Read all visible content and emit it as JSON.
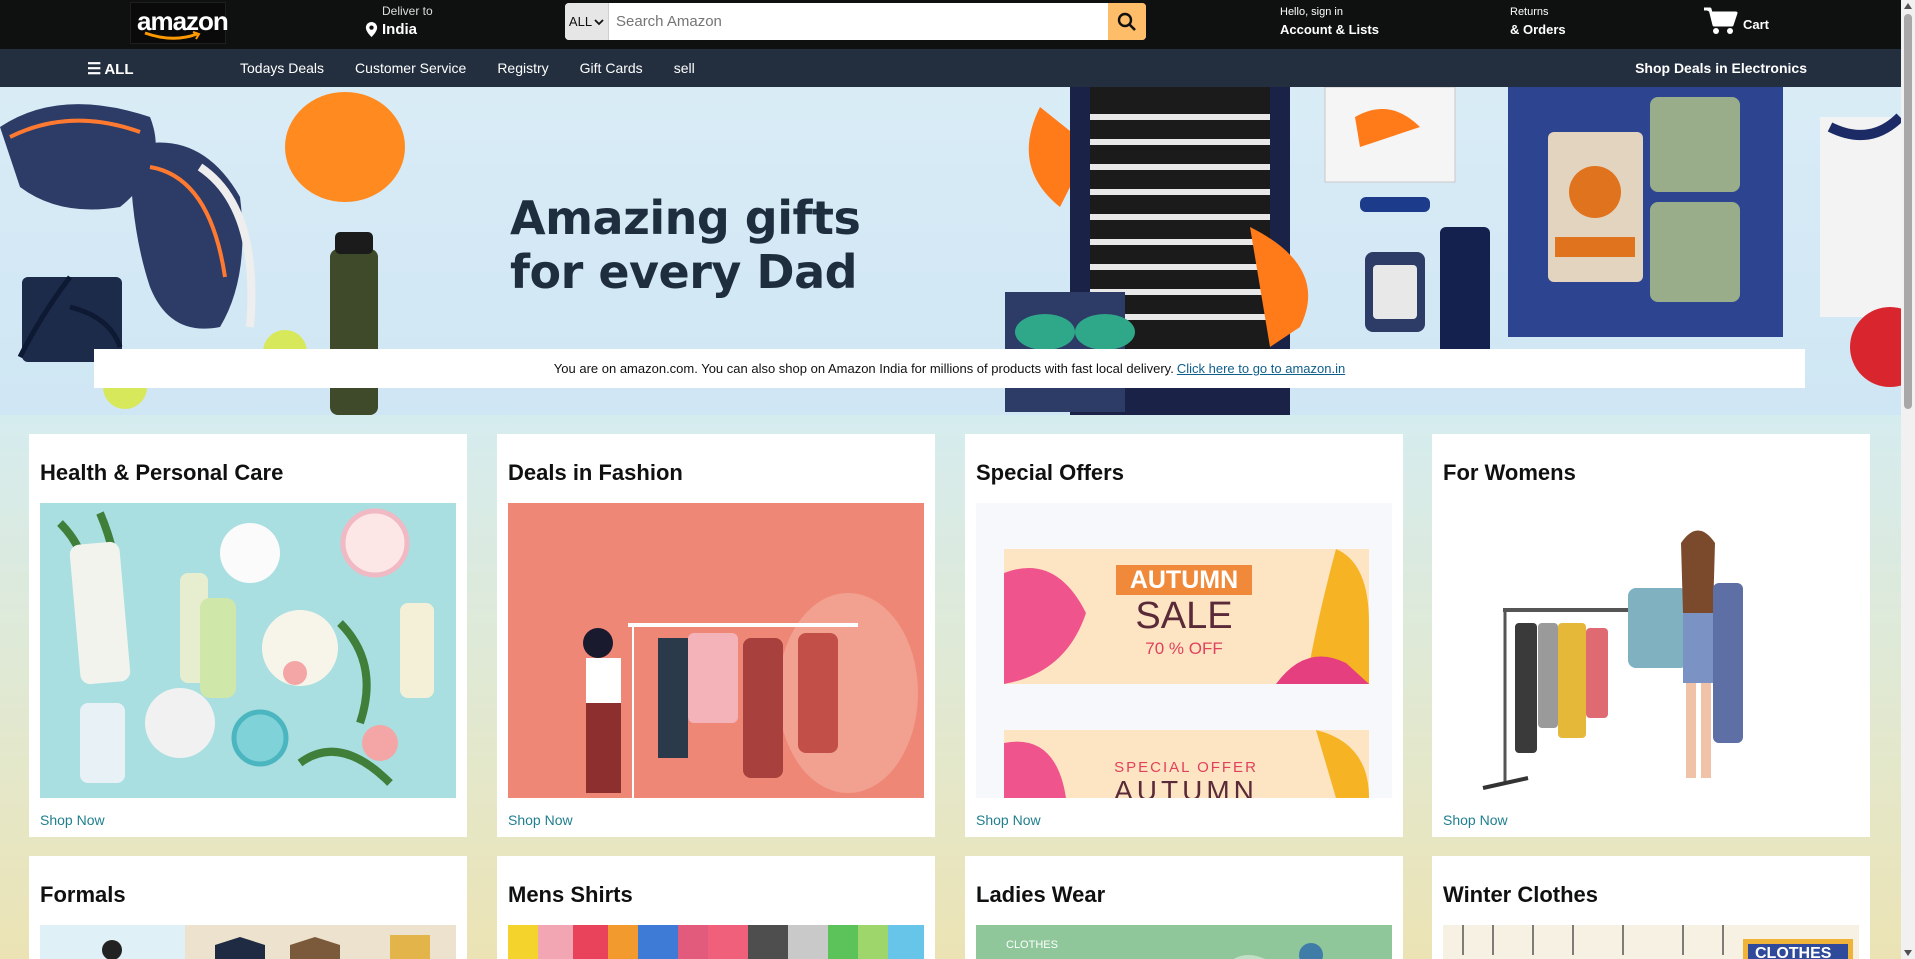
{
  "header": {
    "logo_text": "amazon",
    "deliver_label": "Deliver to",
    "deliver_location": "India",
    "search_category": "ALL",
    "search_placeholder": "Search Amazon",
    "account_greeting": "Hello, sign in",
    "account_label": "Account & Lists",
    "returns_label": "Returns",
    "orders_label": "& Orders",
    "cart_label": "Cart"
  },
  "subnav": {
    "all_label": "ALL",
    "links": [
      "Todays Deals",
      "Customer Service",
      "Registry",
      "Gift Cards",
      "sell"
    ],
    "promo": "Shop Deals in Electronics"
  },
  "hero": {
    "headline_line1": "Amazing gifts",
    "headline_line2": "for every Dad",
    "notice_text": "You are on amazon.com. You can also shop on Amazon India for millions of products with fast local delivery.",
    "notice_link": "Click here to go to amazon.in"
  },
  "cards": [
    {
      "title": "Health & Personal Care",
      "cta": "Shop Now"
    },
    {
      "title": "Deals in Fashion",
      "cta": "Shop Now"
    },
    {
      "title": "Special Offers",
      "cta": "Shop Now",
      "banner1_line1": "AUTUMN",
      "banner1_line2": "SALE",
      "banner1_line3": "70 % OFF",
      "banner2_line1": "SPECIAL OFFER",
      "banner2_line2": "AUTUMN"
    },
    {
      "title": "For Womens",
      "cta": "Shop Now"
    },
    {
      "title": "Formals"
    },
    {
      "title": "Mens Shirts"
    },
    {
      "title": "Ladies Wear",
      "image_text": "CLOTHES"
    },
    {
      "title": "Winter Clothes",
      "image_text": "CLOTHES"
    }
  ],
  "colors": {
    "nav_bg": "#0f1111",
    "subnav_bg": "#232f3e",
    "search_button": "#febd69",
    "link": "#1f7f8f"
  }
}
